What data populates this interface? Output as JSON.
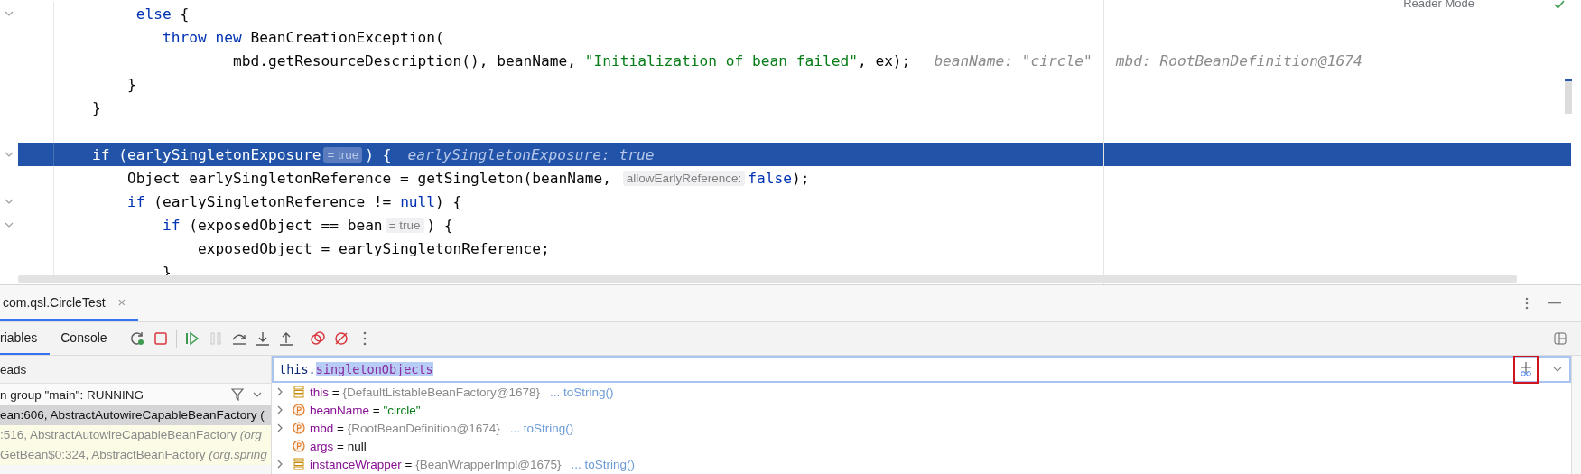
{
  "editor": {
    "reader_mode": "Reader Mode",
    "lines": [
      {
        "highlighted": false,
        "fold": true,
        "tokens": [
          {
            "kind": "code",
            "parts": [
              {
                "kind": "kw",
                "text": "     else"
              },
              {
                "kind": "plain",
                "text": " {"
              }
            ]
          }
        ]
      },
      {
        "highlighted": false,
        "fold": false,
        "tokens": [
          {
            "kind": "code",
            "parts": [
              {
                "kind": "kw",
                "text": "        throw new"
              },
              {
                "kind": "plain",
                "text": " BeanCreationException("
              }
            ]
          }
        ]
      },
      {
        "highlighted": false,
        "fold": false,
        "tokens": [
          {
            "kind": "code",
            "parts": [
              {
                "kind": "plain",
                "text": "                mbd.getResourceDescription(), beanName, "
              },
              {
                "kind": "str",
                "text": "\"Initialization of bean failed\""
              },
              {
                "kind": "plain",
                "text": ", ex);"
              }
            ]
          },
          {
            "kind": "hint",
            "text": "beanName: \"circle\""
          },
          {
            "kind": "hint",
            "text": "mbd: RootBeanDefinition@1674"
          }
        ]
      },
      {
        "highlighted": false,
        "fold": false,
        "tokens": [
          {
            "kind": "code",
            "parts": [
              {
                "kind": "plain",
                "text": "    }"
              }
            ]
          }
        ]
      },
      {
        "highlighted": false,
        "fold": false,
        "tokens": [
          {
            "kind": "code",
            "parts": [
              {
                "kind": "plain",
                "text": "}"
              }
            ]
          }
        ]
      },
      {
        "highlighted": false,
        "fold": false
      },
      {
        "highlighted": true,
        "fold": true,
        "tokens": [
          {
            "kind": "code",
            "parts": [
              {
                "kind": "kw",
                "text": "if"
              },
              {
                "kind": "plain",
                "text": " (earlySingletonExposure"
              }
            ]
          },
          {
            "kind": "inlay",
            "text": "= true"
          },
          {
            "kind": "code",
            "parts": [
              {
                "kind": "plain",
                "text": ") {"
              }
            ]
          },
          {
            "kind": "hint",
            "text": "earlySingletonExposure: true"
          }
        ]
      },
      {
        "highlighted": false,
        "fold": false,
        "tokens": [
          {
            "kind": "code",
            "parts": [
              {
                "kind": "plain",
                "text": "    Object earlySingletonReference = getSingleton(beanName, "
              }
            ]
          },
          {
            "kind": "inlay",
            "text": "allowEarlyReference:"
          },
          {
            "kind": "code",
            "parts": [
              {
                "kind": "kw",
                "text": "false"
              },
              {
                "kind": "plain",
                "text": ");"
              }
            ]
          }
        ]
      },
      {
        "highlighted": false,
        "fold": true,
        "tokens": [
          {
            "kind": "code",
            "parts": [
              {
                "kind": "kw",
                "text": "    if"
              },
              {
                "kind": "plain",
                "text": " (earlySingletonReference != "
              },
              {
                "kind": "kw",
                "text": "null"
              },
              {
                "kind": "plain",
                "text": ") {"
              }
            ]
          }
        ]
      },
      {
        "highlighted": false,
        "fold": true,
        "tokens": [
          {
            "kind": "code",
            "parts": [
              {
                "kind": "kw",
                "text": "        if"
              },
              {
                "kind": "plain",
                "text": " (exposedObject == bean"
              }
            ]
          },
          {
            "kind": "inlay",
            "text": "= true"
          },
          {
            "kind": "code",
            "parts": [
              {
                "kind": "plain",
                "text": ") {"
              }
            ]
          }
        ]
      },
      {
        "highlighted": false,
        "fold": false,
        "tokens": [
          {
            "kind": "code",
            "parts": [
              {
                "kind": "plain",
                "text": "            exposedObject = earlySingletonReference;"
              }
            ]
          }
        ]
      },
      {
        "highlighted": false,
        "fold": false,
        "tokens": [
          {
            "kind": "code",
            "parts": [
              {
                "kind": "plain",
                "text": "        }"
              }
            ]
          }
        ]
      }
    ]
  },
  "debug_panel": {
    "session_tab": {
      "label": "com.qsl.CircleTest",
      "close": "×",
      "selected": true
    },
    "view_tabs": [
      {
        "label": "riables",
        "selected": true
      },
      {
        "label": "Console",
        "selected": false
      }
    ],
    "toolbar": [
      {
        "kind": "rerun",
        "disabled": false
      },
      {
        "kind": "stop",
        "disabled": false
      },
      {
        "kind": "separator"
      },
      {
        "kind": "resume",
        "disabled": false
      },
      {
        "kind": "pause",
        "disabled": true
      },
      {
        "kind": "step_over",
        "disabled": false
      },
      {
        "kind": "step_into",
        "disabled": false
      },
      {
        "kind": "step_out",
        "disabled": false
      },
      {
        "kind": "separator"
      },
      {
        "kind": "breakpoints",
        "disabled": false
      },
      {
        "kind": "mute_breakpoints",
        "disabled": false
      },
      {
        "kind": "more",
        "disabled": false
      }
    ],
    "threads": {
      "header": "eads",
      "thread": "n group \"main\": RUNNING",
      "frames": [
        {
          "text": "ean:606, AbstractAutowireCapableBeanFactory (",
          "selected": true,
          "kind": "library"
        },
        {
          "text": ":516, AbstractAutowireCapableBeanFactory *(org*",
          "selected": false,
          "kind": "library"
        },
        {
          "text": "GetBean$0:324, AbstractBeanFactory *(org.spring*",
          "selected": false,
          "kind": "library"
        }
      ]
    },
    "expression": {
      "parts": [
        {
          "text": "this.",
          "selected": false
        },
        {
          "text": "singletonObjects",
          "selected": true
        }
      ]
    },
    "variables": [
      {
        "name": "this",
        "kind": "field",
        "expandable": true,
        "operator": "=",
        "value": "{DefaultListableBeanFactory@1678}",
        "link": "... toString()"
      },
      {
        "name": "beanName",
        "kind": "param",
        "expandable": true,
        "operator": "=",
        "value": "\"circle\"",
        "color": "#067d17"
      },
      {
        "name": "mbd",
        "kind": "param",
        "expandable": true,
        "operator": "=",
        "value": "{RootBeanDefinition@1674}",
        "link": "... toString()"
      },
      {
        "name": "args",
        "kind": "param",
        "expandable": false,
        "operator": "=",
        "value": "null",
        "color": "#111111"
      },
      {
        "name": "instanceWrapper",
        "kind": "field",
        "expandable": true,
        "operator": "=",
        "value": "{BeanWrapperImpl@1675}",
        "link": "... toString()"
      }
    ]
  }
}
